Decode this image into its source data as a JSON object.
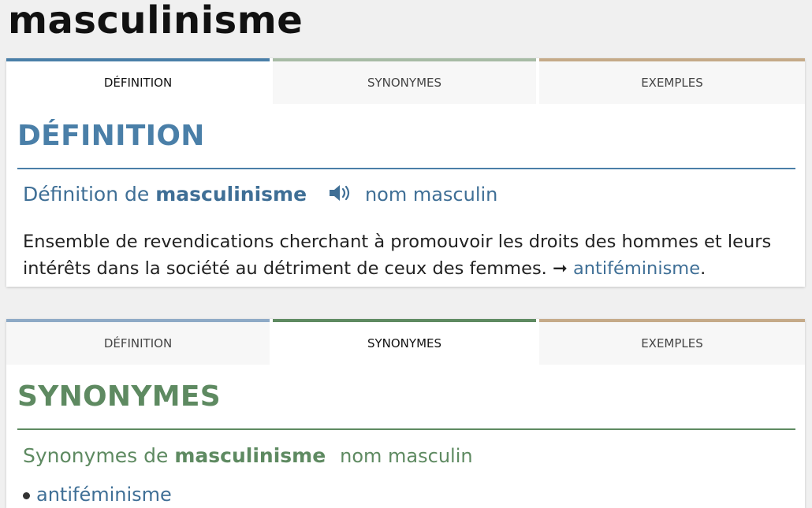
{
  "page": {
    "title": "masculinisme"
  },
  "tabs": [
    "DÉFINITION",
    "SYNONYMES",
    "EXEMPLES"
  ],
  "definition": {
    "heading": "DÉFINITION",
    "subtitle_prefix": "Définition de",
    "word": "masculinisme",
    "pos": "nom masculin",
    "text": "Ensemble de revendications cherchant à promouvoir les droits des hommes et leurs intérêts dans la société au détriment de ceux des femmes.",
    "arrow": "➞",
    "see_also": "antiféminisme",
    "end_punct": "."
  },
  "synonyms": {
    "heading": "SYNONYMES",
    "subtitle_prefix": "Synonymes de",
    "word": "masculinisme",
    "pos": "nom masculin",
    "items": [
      "antiféminisme"
    ]
  },
  "colors": {
    "definition_accent": "#4a7fa8",
    "synonyms_accent": "#5e8a61",
    "examples_accent": "#c5aa88",
    "link": "#3f6f96"
  },
  "icons": {
    "pronunciation": "speaker-icon"
  }
}
